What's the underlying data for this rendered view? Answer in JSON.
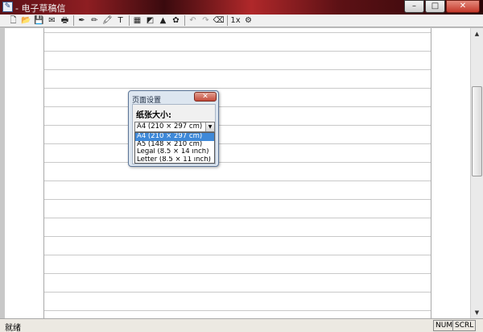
{
  "window": {
    "title": "- 电子草稿信",
    "app_icon_glyph": "✎",
    "minimize_glyph": "–",
    "maximize_glyph": "□",
    "close_glyph": "✕"
  },
  "toolbar": {
    "icons": [
      {
        "name": "new-icon",
        "glyph": "🗋"
      },
      {
        "name": "open-icon",
        "glyph": "📂"
      },
      {
        "name": "save-icon",
        "glyph": "💾"
      },
      {
        "name": "email-icon",
        "glyph": "✉"
      },
      {
        "name": "print-icon",
        "glyph": "🖶"
      },
      {
        "name": "separator",
        "glyph": ""
      },
      {
        "name": "pen-icon",
        "glyph": "✒"
      },
      {
        "name": "pencil-icon",
        "glyph": "✏"
      },
      {
        "name": "marker-icon",
        "glyph": "🖍"
      },
      {
        "name": "text-icon",
        "glyph": "T"
      },
      {
        "name": "separator",
        "glyph": ""
      },
      {
        "name": "grid-icon",
        "glyph": "▦"
      },
      {
        "name": "eraser-icon",
        "glyph": "◩"
      },
      {
        "name": "color-icon",
        "glyph": "▲"
      },
      {
        "name": "stamp-icon",
        "glyph": "✿"
      },
      {
        "name": "separator",
        "glyph": ""
      },
      {
        "name": "undo-icon",
        "glyph": "↶"
      },
      {
        "name": "redo-icon",
        "glyph": "↷"
      },
      {
        "name": "clear-icon",
        "glyph": "⌫"
      },
      {
        "name": "separator",
        "glyph": ""
      },
      {
        "name": "zoom-1x-icon",
        "glyph": "1x"
      },
      {
        "name": "settings-icon",
        "glyph": "⚙"
      }
    ]
  },
  "dialog": {
    "title": "页面设置",
    "close_glyph": "✕",
    "label": "纸张大小:",
    "selected": "A4 (210 × 297 cm)",
    "options": [
      "A4 (210 × 297 cm)",
      "A5 (148 × 210 cm)",
      "Legal (8.5 × 14 inch)",
      "Letter (8.5 × 11 inch)"
    ],
    "selected_index": 0,
    "dropdown_arrow": "▼"
  },
  "statusbar": {
    "text": "就绪",
    "num": "NUM",
    "scrl": "SCRL"
  },
  "scrollbar": {
    "up_glyph": "▲",
    "down_glyph": "▼"
  }
}
